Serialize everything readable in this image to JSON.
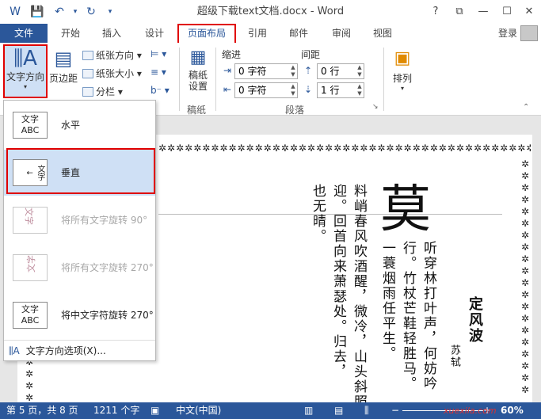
{
  "titlebar": {
    "title": "超级下载text文档.docx - Word",
    "help": "?",
    "restore": "⧉",
    "minimize": "—",
    "maximize": "☐",
    "close": "✕"
  },
  "tabs": {
    "file": "文件",
    "items": [
      "开始",
      "插入",
      "设计",
      "页面布局",
      "引用",
      "邮件",
      "审阅",
      "视图"
    ],
    "login": "登录"
  },
  "ribbon": {
    "text_direction": "文字方向",
    "margins": "页边距",
    "orientation": "纸张方向",
    "size": "纸张大小",
    "columns": "分栏",
    "draft_paper_line1": "稿纸",
    "draft_paper_line2": "设置",
    "draft_group": "稿纸",
    "indent_label": "缩进",
    "spacing_label": "间距",
    "indent_left": "0 字符",
    "indent_right": "0 字符",
    "spacing_before": "0 行",
    "spacing_after": "1 行",
    "paragraph_group": "段落",
    "arrange": "排列"
  },
  "dropdown": {
    "items": [
      {
        "label": "水平",
        "icon": "文字\nABC"
      },
      {
        "label": "垂直",
        "icon": "文字"
      },
      {
        "label": "将所有文字旋转 90°",
        "icon": "文字"
      },
      {
        "label": "将所有文字旋转 270°",
        "icon": "文字"
      },
      {
        "label": "将中文字符旋转 270°",
        "icon": "文字\nABC"
      }
    ],
    "options": "文字方向选项(X)..."
  },
  "document": {
    "stars": "✲✲✲✲✲✲✲✲✲✲✲✲✲✲✲✲✲✲✲✲✲✲✲✲✲✲✲✲✲✲✲✲✲✲✲✲✲✲✲✲✲✲✲✲",
    "poem_title": "定风波",
    "author": "苏轼",
    "big_char": "莫",
    "col1": "听穿林打叶声，何妨吟",
    "col2": "行。竹杖芒鞋轻胜马。",
    "col3": "一蓑烟雨任平生。",
    "col4": "料峭春风吹酒醒，微冷，山头斜照",
    "col5": "迎。回首向来萧瑟处。归去，",
    "col6": "也无晴。"
  },
  "statusbar": {
    "page": "第 5 页，共 8 页",
    "words": "1211 个字",
    "language": "中文(中国)",
    "zoom": "60%",
    "watermark": "xuexila.com"
  }
}
